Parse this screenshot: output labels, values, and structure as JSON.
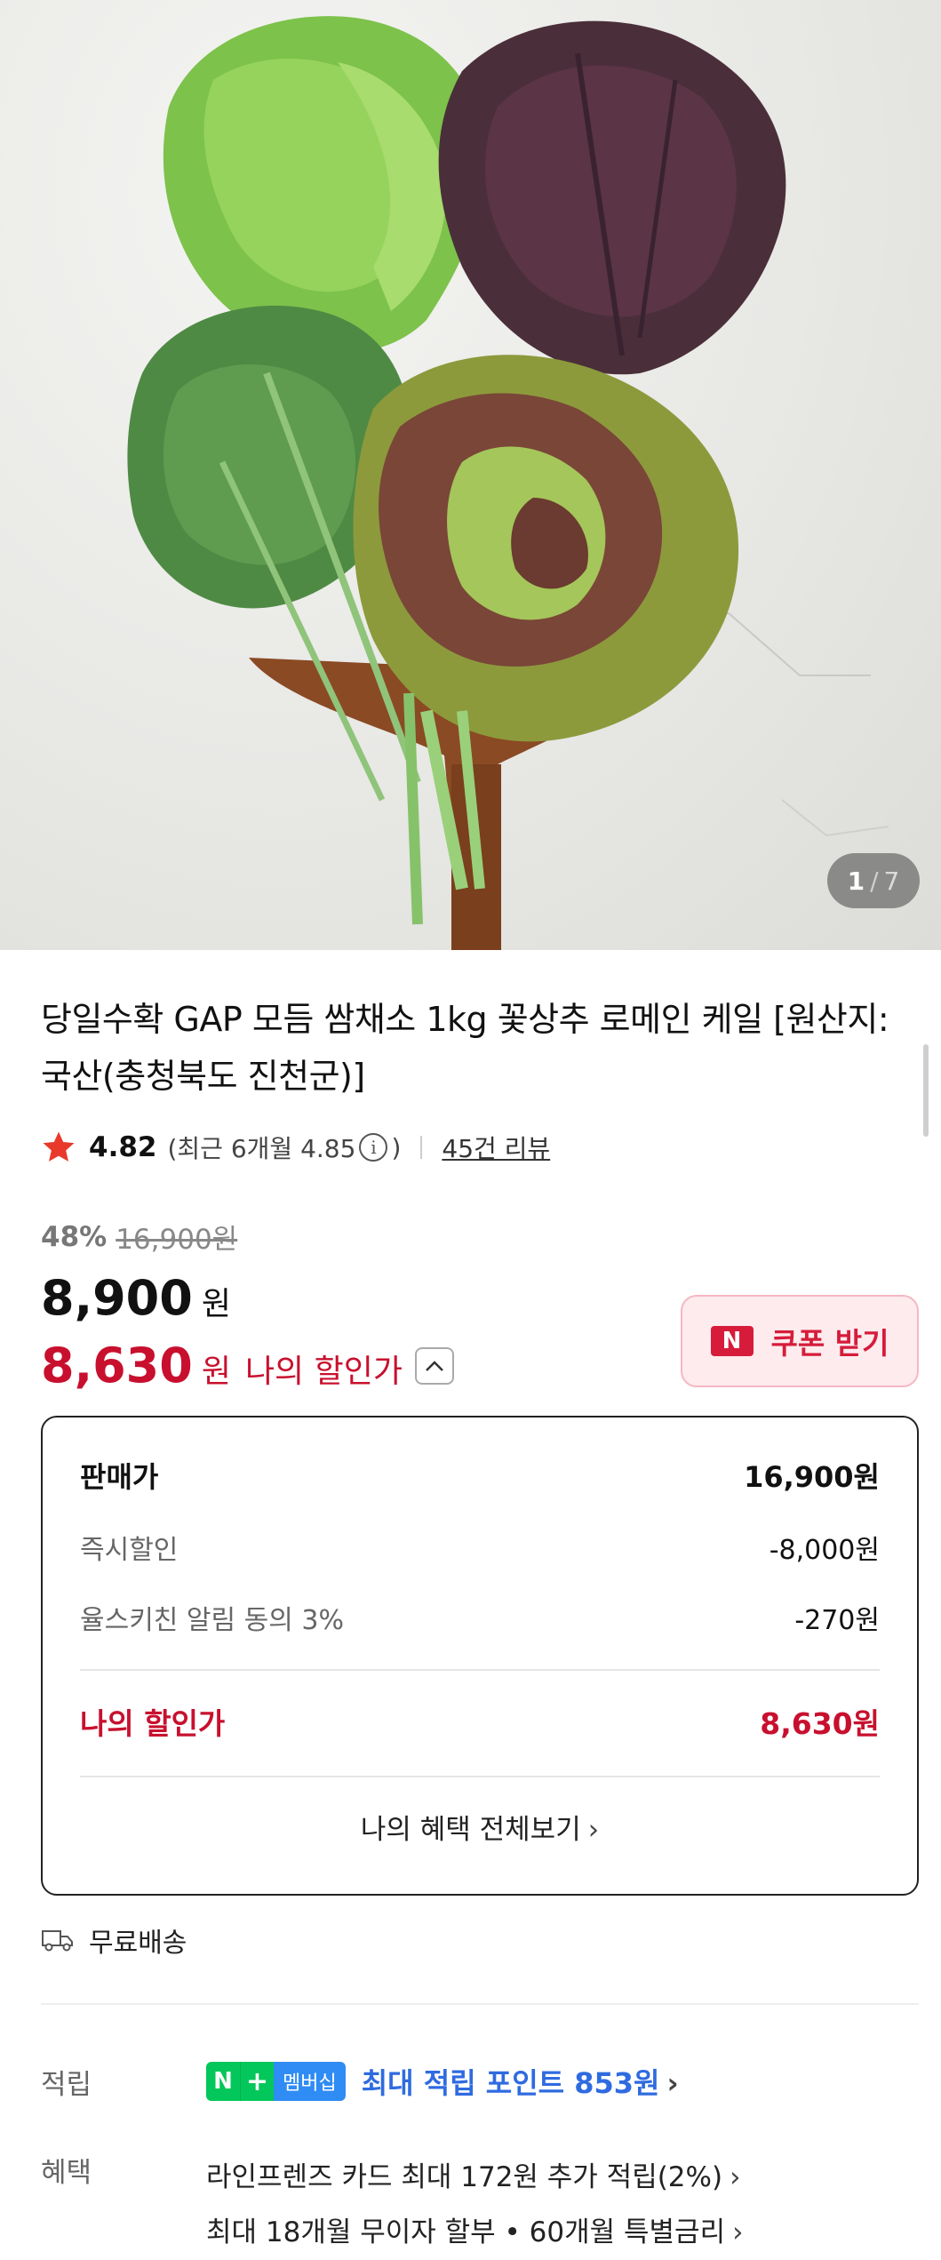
{
  "hero": {
    "pager_current": "1",
    "pager_sep": "/",
    "pager_total": "7"
  },
  "product": {
    "title": "당일수확 GAP 모듬 쌈채소 1kg 꽃상추 로메인 케일 [원산지:국산(충청북도 진천군)]"
  },
  "rating": {
    "score": "4.82",
    "recent_prefix": "(최근 6개월 4.85",
    "recent_suffix": ")",
    "info_glyph": "i",
    "reviews": "45건 리뷰"
  },
  "price": {
    "discount_rate": "48%",
    "original": "16,900원",
    "sale": "8,900",
    "unit": "원",
    "my_price": "8,630",
    "my_unit": "원",
    "my_label": "나의 할인가"
  },
  "coupon": {
    "badge": "N",
    "label": "쿠폰 받기"
  },
  "breakdown": {
    "sale_label": "판매가",
    "sale_value": "16,900원",
    "instant_label": "즉시할인",
    "instant_value": "-8,000원",
    "alarm_label": "율스키친 알림 동의 3%",
    "alarm_value": "-270원",
    "mine_label": "나의 할인가",
    "mine_value": "8,630원",
    "all_benefits": "나의 혜택 전체보기",
    "chevron": "›"
  },
  "shipping": {
    "label": "무료배송"
  },
  "points": {
    "label": "적립",
    "badge_n": "N",
    "badge_plus": "+",
    "badge_membership": "멤버십",
    "text": "최대 적립 포인트 853원",
    "chevron": "›"
  },
  "benefits": {
    "label": "혜택",
    "line1": "라인프렌즈 카드 최대 172원 추가 적립(2%)",
    "line2": "최대 18개월 무이자 할부 • 60개월 특별금리",
    "chevron": "›"
  },
  "colors": {
    "discount_red": "#c8102e",
    "coupon_red": "#d61c3a",
    "naver_green": "#03c75a",
    "points_blue": "#2f6be0"
  }
}
